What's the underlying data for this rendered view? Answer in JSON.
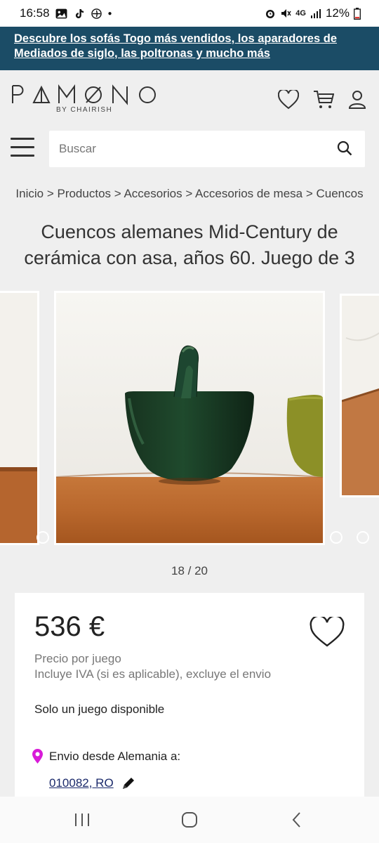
{
  "status_bar": {
    "time": "16:58",
    "network": "4G",
    "battery": "12%"
  },
  "promo": {
    "text": "Descubre los sofás Togo más vendidos, los aparadores de Mediados de siglo, las poltronas y mucho más"
  },
  "header": {
    "logo": "PAMONO",
    "logo_sub": "BY CHAIRISH"
  },
  "search": {
    "placeholder": "Buscar"
  },
  "breadcrumb": "Inicio > Productos > Accesorios > Accesorios de mesa > Cuencos",
  "product": {
    "title": "Cuencos alemanes Mid-Century de cerámica con asa, años 60. Juego de 3",
    "counter": "18 / 20",
    "price": "536 €",
    "price_unit": "Precio por juego",
    "price_note": "Incluye IVA (si es aplicable), excluye el envio",
    "availability": "Solo un juego disponible",
    "shipping_label": "Envio desde Alemania a:",
    "zip": "010082, RO"
  },
  "colors": {
    "banner": "#1b4c66",
    "background": "#efefef",
    "accent_pin": "#d81bd8"
  }
}
